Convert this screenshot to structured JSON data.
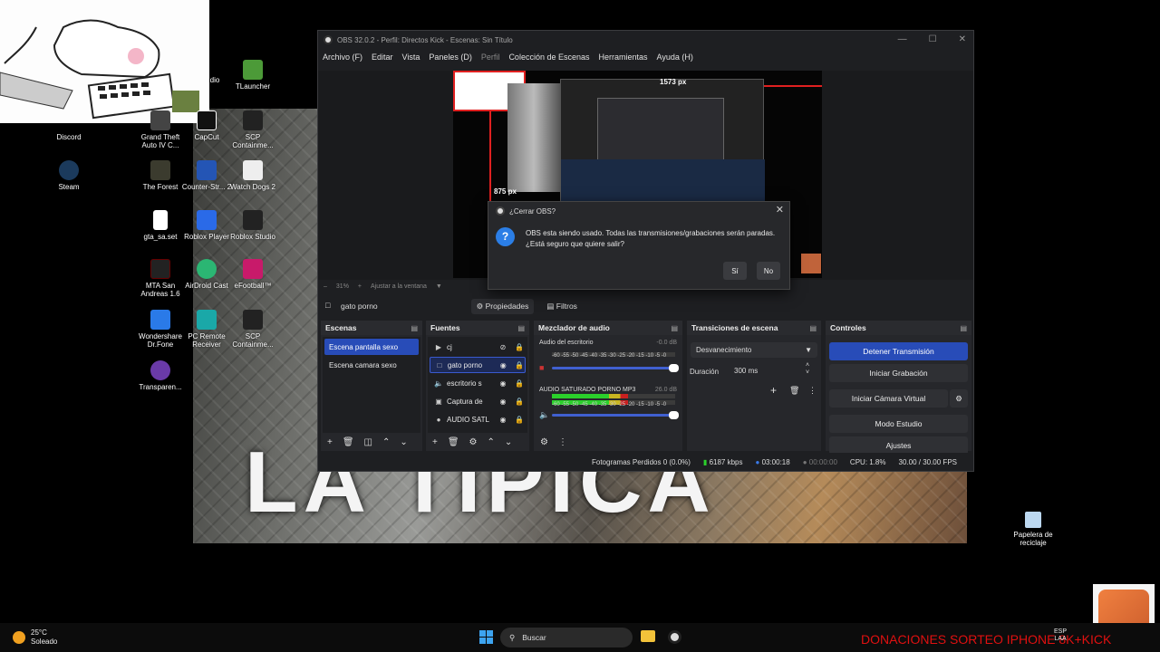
{
  "desktop": {
    "icons": [
      {
        "label": "Discord"
      },
      {
        "label": "Steam"
      },
      {
        "label": "Grand Theft Auto IV C..."
      },
      {
        "label": "The Forest"
      },
      {
        "label": "gta_sa.set"
      },
      {
        "label": "MTA San Andreas 1.6"
      },
      {
        "label": "Wondershare Dr.Fone"
      },
      {
        "label": "Transparen..."
      },
      {
        "label": "dio"
      },
      {
        "label": "CapCut"
      },
      {
        "label": "Counter-Str... 2"
      },
      {
        "label": "Roblox Player"
      },
      {
        "label": "AirDroid Cast"
      },
      {
        "label": "PC Remote Receiver"
      },
      {
        "label": "TLauncher"
      },
      {
        "label": "SCP Containme..."
      },
      {
        "label": "Watch Dogs 2"
      },
      {
        "label": "Roblox Studio"
      },
      {
        "label": "eFootball™"
      },
      {
        "label": "SCP Containme..."
      }
    ],
    "recycle_bin": "Papelera de reciclaje",
    "video_caption": "LA TIPICA"
  },
  "obs": {
    "title": "OBS 32.0.2 - Perfil: Directos Kick - Escenas: Sin Título",
    "menu": [
      "Archivo (F)",
      "Editar",
      "Vista",
      "Paneles (D)",
      "Perfil",
      "Colección de Escenas",
      "Herramientas",
      "Ayuda (H)"
    ],
    "preview": {
      "width_label": "1573 px",
      "height_label": "875 px",
      "zoom": "31%",
      "fit_label": "Ajustar a la ventana"
    },
    "source_toolbar": {
      "selected_source": "gato porno",
      "properties": "Propiedades",
      "filters": "Filtros"
    },
    "scenes": {
      "title": "Escenas",
      "items": [
        {
          "label": "Escena pantalla sexo",
          "selected": true
        },
        {
          "label": "Escena camara sexo",
          "selected": false
        }
      ]
    },
    "sources": {
      "title": "Fuentes",
      "items": [
        {
          "label": "cj",
          "icon": "play-icon"
        },
        {
          "label": "gato porno",
          "icon": "image-icon"
        },
        {
          "label": "escritorio s",
          "icon": "speaker-icon"
        },
        {
          "label": "Captura de",
          "icon": "monitor-icon"
        },
        {
          "label": "AUDIO SATL",
          "icon": "microphone-icon"
        }
      ]
    },
    "mixer": {
      "title": "Mezclador de audio",
      "channels": [
        {
          "name": "Audio del escritorio",
          "db": "-0.0 dB",
          "level": 0
        },
        {
          "name": "AUDIO SATURADO PORNO MP3",
          "db": "26.0 dB",
          "level": 0.62
        }
      ],
      "scale": "-60 -55 -50 -45 -40 -35 -30 -25 -20 -15 -10 -5 -0"
    },
    "transitions": {
      "title": "Transiciones de escena",
      "selected": "Desvanecimiento",
      "duration_label": "Duración",
      "duration_value": "300 ms"
    },
    "controls": {
      "title": "Controles",
      "buttons": [
        "Detener Transmisión",
        "Iniciar Grabación",
        "Iniciar Cámara Virtual",
        "Modo Estudio",
        "Ajustes"
      ]
    },
    "status": {
      "dropped": "Fotogramas Perdidos 0 (0.0%)",
      "bitrate": "6187 kbps",
      "stream_time": "03:00:18",
      "rec_time": "00:00:00",
      "cpu": "CPU: 1.8%",
      "fps": "30.00 / 30.00 FPS"
    }
  },
  "dialog": {
    "title": "¿Cerrar OBS?",
    "message": "OBS esta siendo usado. Todas las transmisiones/grabaciones serán paradas. ¿Está seguro que quiere salir?",
    "yes": "Sí",
    "no": "No"
  },
  "taskbar": {
    "weather_temp": "25°C",
    "weather_desc": "Soleado",
    "search": "Buscar",
    "lang": "ESP",
    "lang2": "LAA",
    "donations": "DONACIONES SORTEO IPHONE 8K+KICK"
  },
  "colors": {
    "accent": "#284cb8",
    "donations": "#e01010"
  }
}
